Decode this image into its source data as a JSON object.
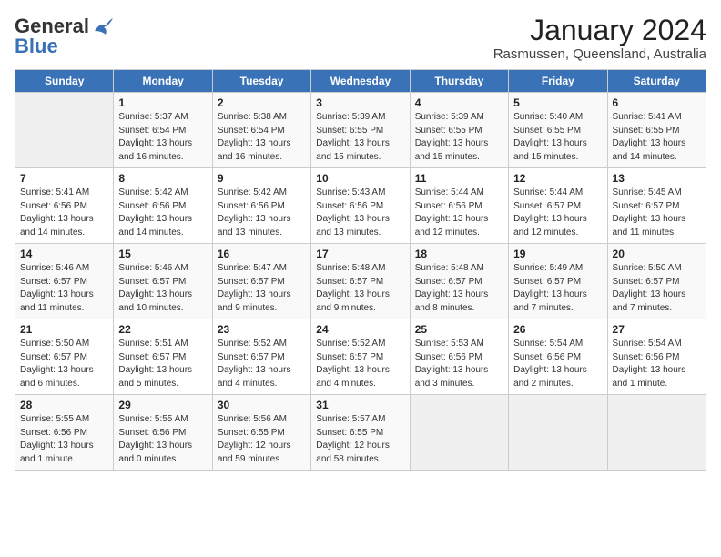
{
  "logo": {
    "general": "General",
    "blue": "Blue"
  },
  "title": "January 2024",
  "location": "Rasmussen, Queensland, Australia",
  "days_of_week": [
    "Sunday",
    "Monday",
    "Tuesday",
    "Wednesday",
    "Thursday",
    "Friday",
    "Saturday"
  ],
  "weeks": [
    [
      {
        "num": "",
        "info": ""
      },
      {
        "num": "1",
        "info": "Sunrise: 5:37 AM\nSunset: 6:54 PM\nDaylight: 13 hours\nand 16 minutes."
      },
      {
        "num": "2",
        "info": "Sunrise: 5:38 AM\nSunset: 6:54 PM\nDaylight: 13 hours\nand 16 minutes."
      },
      {
        "num": "3",
        "info": "Sunrise: 5:39 AM\nSunset: 6:55 PM\nDaylight: 13 hours\nand 15 minutes."
      },
      {
        "num": "4",
        "info": "Sunrise: 5:39 AM\nSunset: 6:55 PM\nDaylight: 13 hours\nand 15 minutes."
      },
      {
        "num": "5",
        "info": "Sunrise: 5:40 AM\nSunset: 6:55 PM\nDaylight: 13 hours\nand 15 minutes."
      },
      {
        "num": "6",
        "info": "Sunrise: 5:41 AM\nSunset: 6:55 PM\nDaylight: 13 hours\nand 14 minutes."
      }
    ],
    [
      {
        "num": "7",
        "info": "Sunrise: 5:41 AM\nSunset: 6:56 PM\nDaylight: 13 hours\nand 14 minutes."
      },
      {
        "num": "8",
        "info": "Sunrise: 5:42 AM\nSunset: 6:56 PM\nDaylight: 13 hours\nand 14 minutes."
      },
      {
        "num": "9",
        "info": "Sunrise: 5:42 AM\nSunset: 6:56 PM\nDaylight: 13 hours\nand 13 minutes."
      },
      {
        "num": "10",
        "info": "Sunrise: 5:43 AM\nSunset: 6:56 PM\nDaylight: 13 hours\nand 13 minutes."
      },
      {
        "num": "11",
        "info": "Sunrise: 5:44 AM\nSunset: 6:56 PM\nDaylight: 13 hours\nand 12 minutes."
      },
      {
        "num": "12",
        "info": "Sunrise: 5:44 AM\nSunset: 6:57 PM\nDaylight: 13 hours\nand 12 minutes."
      },
      {
        "num": "13",
        "info": "Sunrise: 5:45 AM\nSunset: 6:57 PM\nDaylight: 13 hours\nand 11 minutes."
      }
    ],
    [
      {
        "num": "14",
        "info": "Sunrise: 5:46 AM\nSunset: 6:57 PM\nDaylight: 13 hours\nand 11 minutes."
      },
      {
        "num": "15",
        "info": "Sunrise: 5:46 AM\nSunset: 6:57 PM\nDaylight: 13 hours\nand 10 minutes."
      },
      {
        "num": "16",
        "info": "Sunrise: 5:47 AM\nSunset: 6:57 PM\nDaylight: 13 hours\nand 9 minutes."
      },
      {
        "num": "17",
        "info": "Sunrise: 5:48 AM\nSunset: 6:57 PM\nDaylight: 13 hours\nand 9 minutes."
      },
      {
        "num": "18",
        "info": "Sunrise: 5:48 AM\nSunset: 6:57 PM\nDaylight: 13 hours\nand 8 minutes."
      },
      {
        "num": "19",
        "info": "Sunrise: 5:49 AM\nSunset: 6:57 PM\nDaylight: 13 hours\nand 7 minutes."
      },
      {
        "num": "20",
        "info": "Sunrise: 5:50 AM\nSunset: 6:57 PM\nDaylight: 13 hours\nand 7 minutes."
      }
    ],
    [
      {
        "num": "21",
        "info": "Sunrise: 5:50 AM\nSunset: 6:57 PM\nDaylight: 13 hours\nand 6 minutes."
      },
      {
        "num": "22",
        "info": "Sunrise: 5:51 AM\nSunset: 6:57 PM\nDaylight: 13 hours\nand 5 minutes."
      },
      {
        "num": "23",
        "info": "Sunrise: 5:52 AM\nSunset: 6:57 PM\nDaylight: 13 hours\nand 4 minutes."
      },
      {
        "num": "24",
        "info": "Sunrise: 5:52 AM\nSunset: 6:57 PM\nDaylight: 13 hours\nand 4 minutes."
      },
      {
        "num": "25",
        "info": "Sunrise: 5:53 AM\nSunset: 6:56 PM\nDaylight: 13 hours\nand 3 minutes."
      },
      {
        "num": "26",
        "info": "Sunrise: 5:54 AM\nSunset: 6:56 PM\nDaylight: 13 hours\nand 2 minutes."
      },
      {
        "num": "27",
        "info": "Sunrise: 5:54 AM\nSunset: 6:56 PM\nDaylight: 13 hours\nand 1 minute."
      }
    ],
    [
      {
        "num": "28",
        "info": "Sunrise: 5:55 AM\nSunset: 6:56 PM\nDaylight: 13 hours\nand 1 minute."
      },
      {
        "num": "29",
        "info": "Sunrise: 5:55 AM\nSunset: 6:56 PM\nDaylight: 13 hours\nand 0 minutes."
      },
      {
        "num": "30",
        "info": "Sunrise: 5:56 AM\nSunset: 6:55 PM\nDaylight: 12 hours\nand 59 minutes."
      },
      {
        "num": "31",
        "info": "Sunrise: 5:57 AM\nSunset: 6:55 PM\nDaylight: 12 hours\nand 58 minutes."
      },
      {
        "num": "",
        "info": ""
      },
      {
        "num": "",
        "info": ""
      },
      {
        "num": "",
        "info": ""
      }
    ]
  ]
}
